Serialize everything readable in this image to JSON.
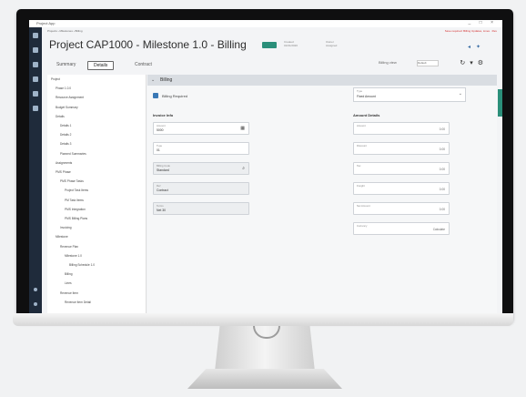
{
  "app": {
    "title": "Project CAP1000 - Milestone 1.0 - Billing",
    "window_title": "Project App",
    "window_controls": "_ □ ×",
    "breadcrumb": "Projects › Milestones › Billing",
    "warning_text": "Save required: Billing Updates, Lines · Rev"
  },
  "header": {
    "status_badge": "",
    "meta": [
      {
        "label": "Created",
        "value": "01/01/2020"
      },
      {
        "label": "Owner",
        "value": "Assigned"
      }
    ],
    "icons": [
      "share-icon",
      "pin-icon"
    ]
  },
  "tabs": [
    {
      "label": "Summary"
    },
    {
      "label": "Details"
    },
    {
      "label": "Contract"
    }
  ],
  "active_tab": 1,
  "toolbar": {
    "view_label": "Billing view",
    "select_value": "Default",
    "icons": [
      "refresh-icon",
      "filter-icon",
      "settings-icon"
    ]
  },
  "tree": {
    "items": [
      {
        "label": "Project",
        "level": 0
      },
      {
        "label": "Phase 1.0.0",
        "level": 1
      },
      {
        "label": "Resource Assignment",
        "level": 1
      },
      {
        "label": "Budget Summary",
        "level": 1
      },
      {
        "label": "Details",
        "level": 1
      },
      {
        "label": "Details 1",
        "level": 2
      },
      {
        "label": "Details 2",
        "level": 2
      },
      {
        "label": "Details 3",
        "level": 2
      },
      {
        "label": "Planned Summaries",
        "level": 2
      },
      {
        "label": "Assignments",
        "level": 1
      },
      {
        "label": "PMS Phase",
        "level": 1
      },
      {
        "label": "PMS Phase Tasks",
        "level": 2
      },
      {
        "label": "Project Task Items",
        "level": 3
      },
      {
        "label": "PM Task Items",
        "level": 3
      },
      {
        "label": "PMS Integration",
        "level": 3
      },
      {
        "label": "PMS Billing Plans",
        "level": 3
      },
      {
        "label": "Invoicing",
        "level": 2
      },
      {
        "label": "Milestone",
        "level": 1
      },
      {
        "label": "Revenue Plan",
        "level": 2
      },
      {
        "label": "Milestone 1.0",
        "level": 3
      },
      {
        "label": "Billing Schedule 1.0",
        "level": 4
      },
      {
        "label": "Billing",
        "level": 3
      },
      {
        "label": "Lines",
        "level": 3
      },
      {
        "label": "Revenue Item",
        "level": 2
      },
      {
        "label": "Revenue Item Detail",
        "level": 3
      }
    ]
  },
  "content": {
    "section_label": "Billing",
    "checkbox_label": "Billing Required",
    "invoice_select": {
      "label": "Type",
      "value": "Fixed Amount"
    },
    "left_heading": "Invoice Info",
    "left_fields": [
      {
        "label": "Amount",
        "value": "5000",
        "icon": "calendar-icon"
      },
      {
        "label": "Type",
        "value": "01"
      },
      {
        "label": "Billing Code",
        "value": "Standard",
        "icon": "search-icon",
        "ro": true
      },
      {
        "label": "Ref",
        "value": "Contract",
        "ro": true
      },
      {
        "label": "Terms",
        "value": "Net 30",
        "ro": true
      }
    ],
    "right_heading": "Amount Details",
    "right_fields": [
      {
        "label": "Amount",
        "value": "0.00"
      },
      {
        "label": "Discount",
        "value": "0.00"
      },
      {
        "label": "Tax",
        "value": "0.00"
      },
      {
        "label": "Freight",
        "value": "0.00"
      },
      {
        "label": "Net Amount",
        "value": "0.00"
      },
      {
        "label": "Currency",
        "value": "Calculate"
      }
    ]
  },
  "colors": {
    "accent": "#2b8f7a",
    "rail": "#1f2b3b",
    "link": "#3b6ea5",
    "warning": "#d32f2f"
  }
}
